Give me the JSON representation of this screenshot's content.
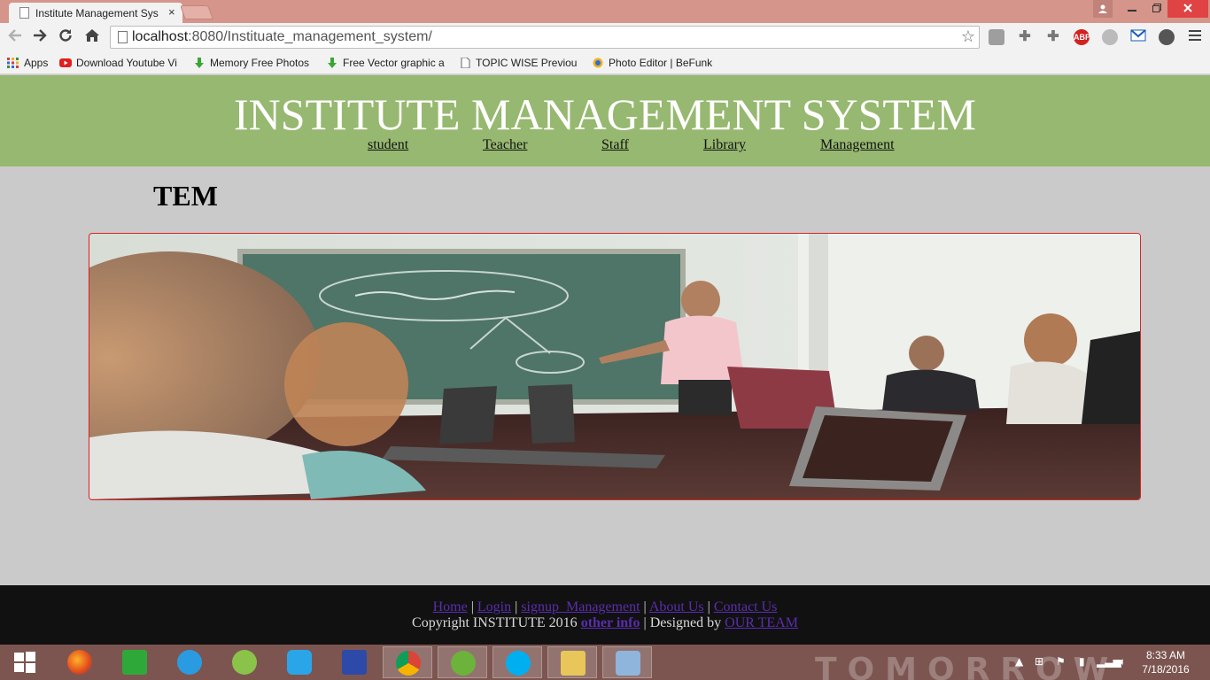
{
  "browser": {
    "tab_title": "Institute Management Sys",
    "tab_close": "×",
    "url_host": "localhost",
    "url_path": ":8080/Instituate_management_system/",
    "extensions": [
      "ABP"
    ]
  },
  "bookmarks": [
    {
      "label": "Apps",
      "icon": "apps-grid-icon"
    },
    {
      "label": "Download Youtube Vi",
      "icon": "youtube-icon"
    },
    {
      "label": "Memory Free Photos",
      "icon": "download-arrow-icon"
    },
    {
      "label": "Free Vector graphic a",
      "icon": "download-arrow-icon"
    },
    {
      "label": "TOPIC WISE Previous",
      "icon": "page-icon"
    },
    {
      "label": "Photo Editor | BeFunk",
      "icon": "befunky-icon"
    }
  ],
  "site": {
    "title": "INSTITUTE MANAGEMENT SYSTEM",
    "nav": [
      "student",
      "Teacher",
      "Staff",
      "Library",
      "Management"
    ],
    "heading": "TEM"
  },
  "footer": {
    "links": [
      "Home",
      "Login",
      "signup_Management",
      "About Us",
      "Contact Us"
    ],
    "separator": "|",
    "copyright": "Copyright INSTITUTE 2016",
    "other_info": "other info",
    "designed_by": "Designed by",
    "team": "OUR TEAM"
  },
  "taskbar": {
    "time": "8:33 AM",
    "date": "7/18/2016",
    "apps": [
      "start-icon",
      "firefox-icon",
      "store-icon",
      "ie-icon",
      "android-studio-icon",
      "shareit-icon",
      "devcpp-icon",
      "chrome-icon",
      "utorrent-icon",
      "skype-icon",
      "file-explorer-icon",
      "virtualbox-icon"
    ]
  },
  "colors": {
    "header": "#97b870",
    "page_bg": "#cacaca",
    "footer_bg": "#111111",
    "link": "#5a2dae",
    "hero_border": "#e02020"
  }
}
